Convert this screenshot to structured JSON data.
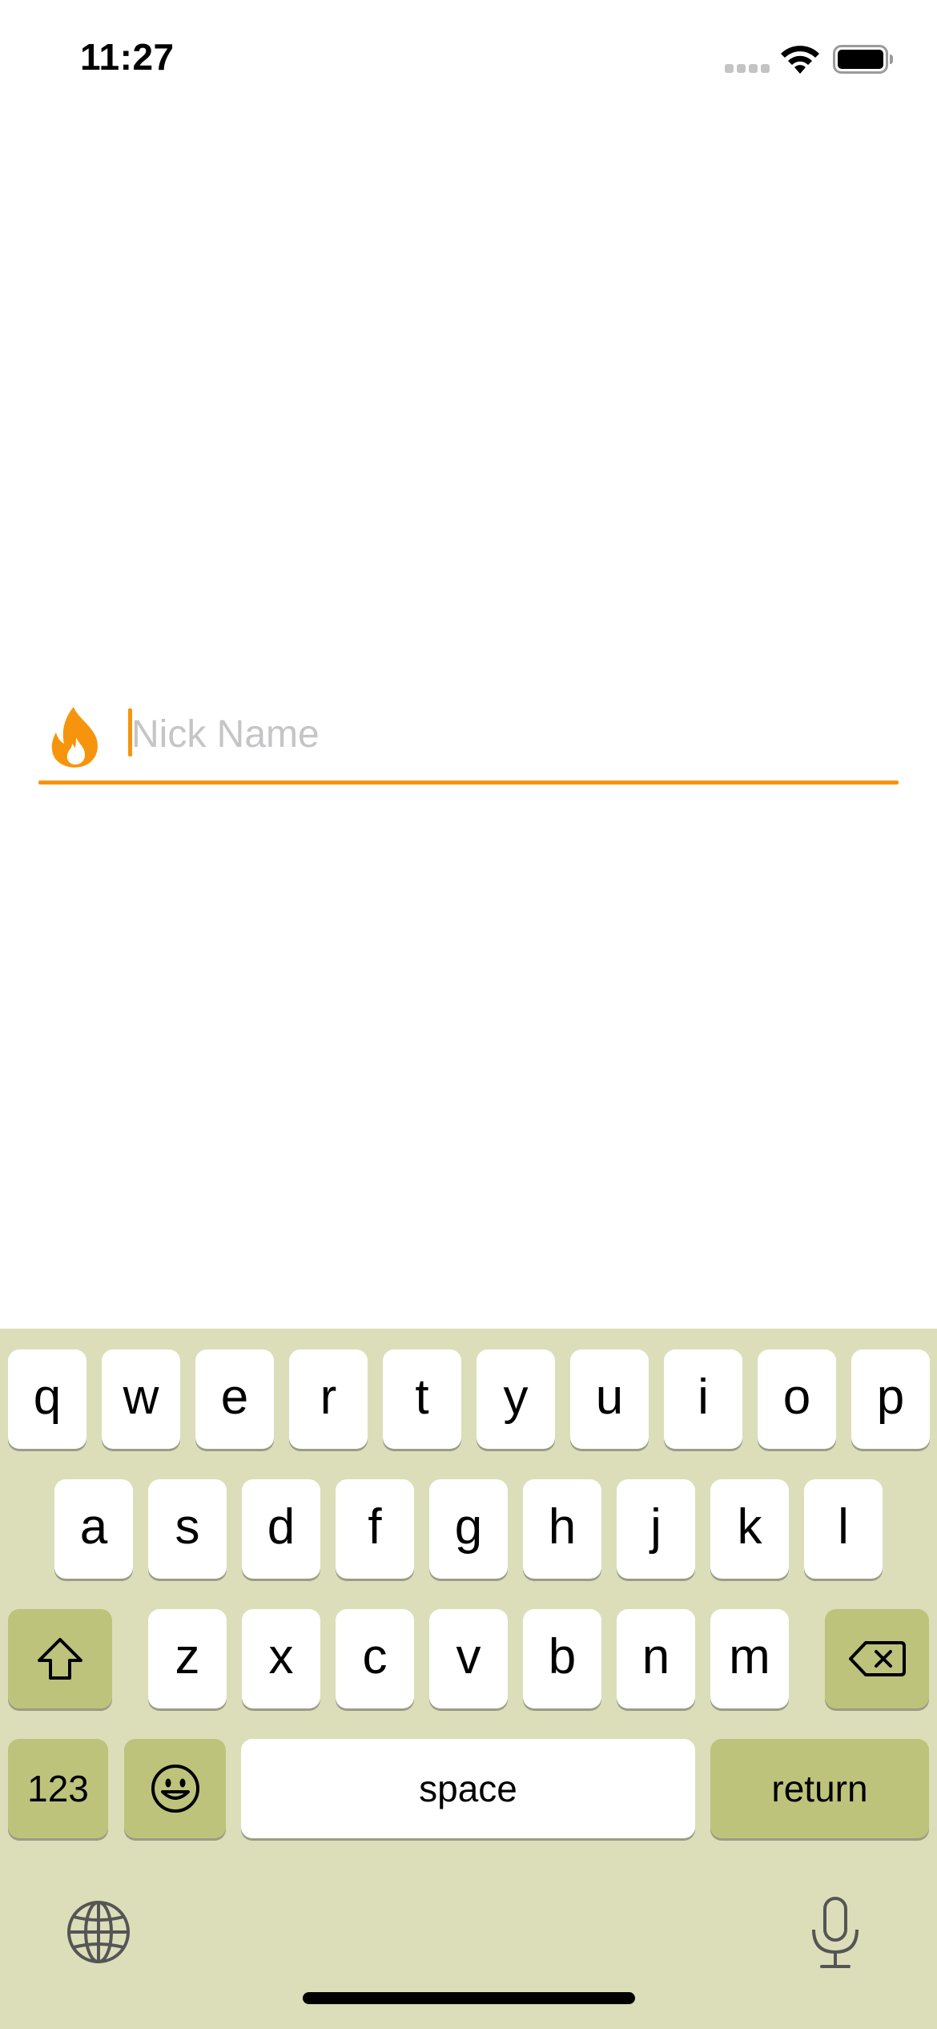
{
  "status_bar": {
    "time": "11:27",
    "icons": [
      "cellular-signal-icon",
      "wifi-icon",
      "battery-icon"
    ]
  },
  "nickname_field": {
    "icon": "fire-icon",
    "placeholder": "Nick Name",
    "value": "",
    "accent_color": "#f6950d"
  },
  "keyboard": {
    "background_color": "#dbdeb8",
    "function_key_color": "#bdc37b",
    "row1": [
      "q",
      "w",
      "e",
      "r",
      "t",
      "y",
      "u",
      "i",
      "o",
      "p"
    ],
    "row2": [
      "a",
      "s",
      "d",
      "f",
      "g",
      "h",
      "j",
      "k",
      "l"
    ],
    "row3": [
      "z",
      "x",
      "c",
      "v",
      "b",
      "n",
      "m"
    ],
    "shift_icon": "shift-icon",
    "delete_icon": "delete-icon",
    "numbers_label": "123",
    "emoji_icon": "emoji-icon",
    "space_label": "space",
    "return_label": "return",
    "globe_icon": "globe-icon",
    "mic_icon": "microphone-icon"
  }
}
